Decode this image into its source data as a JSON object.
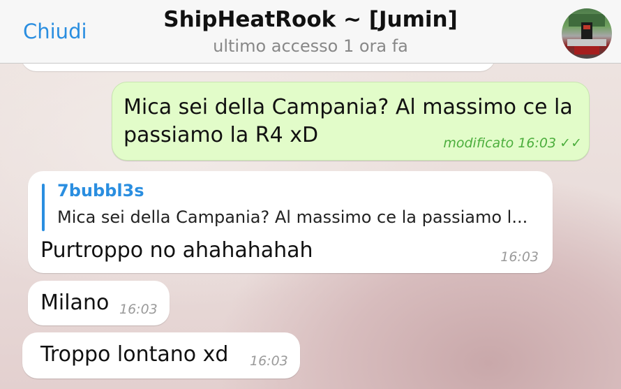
{
  "header": {
    "back_label": "Chiudi",
    "title": "ShipHeatRook ~ [Jumin]",
    "subtitle": "ultimo accesso 1 ora fa"
  },
  "messages": [
    {
      "direction": "outgoing",
      "text_line1": "Mica sei della Campania? Al massimo ce la",
      "text_line2": "passiamo la R4 xD",
      "meta": "modificato 16:03",
      "status": "read"
    },
    {
      "direction": "incoming",
      "reply_to": {
        "author": "7bubbl3s",
        "snippet": "Mica sei della Campania? Al massimo ce la passiamo l..."
      },
      "text": "Purtroppo no ahahahahah",
      "time": "16:03"
    },
    {
      "direction": "incoming",
      "text": "Milano",
      "time": "16:03"
    },
    {
      "direction": "incoming",
      "text": "Troppo lontano xd",
      "time": "16:03"
    }
  ],
  "icons": {
    "read_receipt": "double-check-icon"
  },
  "colors": {
    "accent": "#2a8ee0",
    "outgoing_bubble": "#e2fcc9",
    "read_check": "#4cae3d"
  }
}
